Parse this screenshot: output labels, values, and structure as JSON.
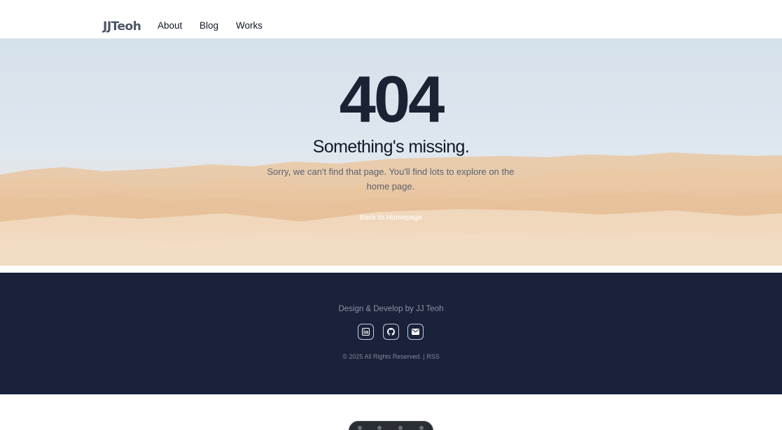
{
  "header": {
    "logo": "JJTeoh",
    "nav": [
      "About",
      "Blog",
      "Works"
    ]
  },
  "hero": {
    "code": "404",
    "title": "Something's missing.",
    "message": "Sorry, we can't find that page. You'll find lots to explore on the home page.",
    "back_link": "Back to Homepage"
  },
  "footer": {
    "credit": "Design & Develop by JJ Teoh",
    "socials": [
      {
        "icon": "linkedin-icon"
      },
      {
        "icon": "github-icon"
      },
      {
        "icon": "mail-icon"
      }
    ],
    "copyright": "© 2025 All Rights Reserved. |",
    "rss": "RSS"
  },
  "colors": {
    "footer_bg": "#19223a",
    "heading": "#1a2233",
    "sand": "#e9c9a4"
  }
}
